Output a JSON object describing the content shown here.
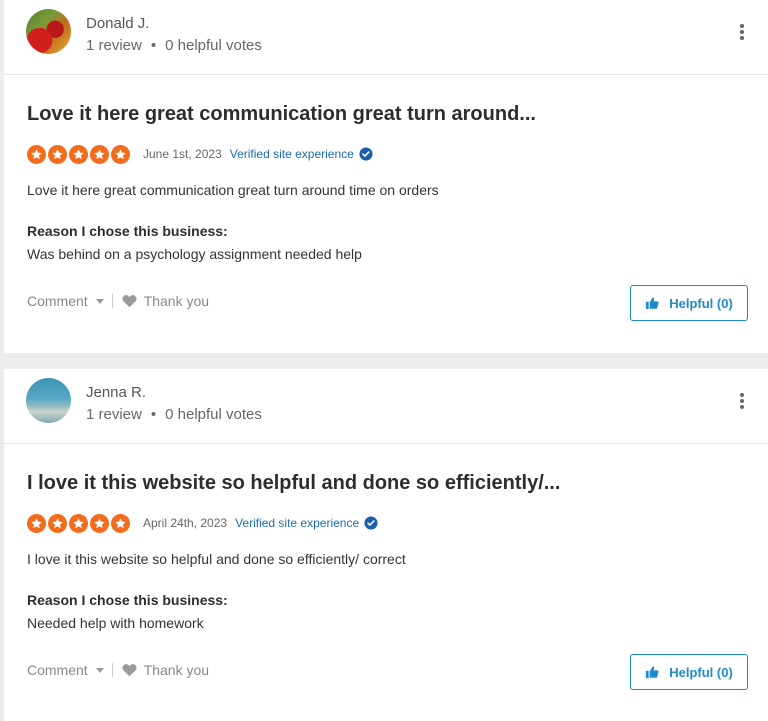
{
  "reviews": [
    {
      "reviewer_name": "Donald J.",
      "reviews_count": "1 review",
      "separator": "•",
      "helpful_votes": "0 helpful votes",
      "title": "Love it here great communication great turn around...",
      "rating": 5,
      "date": "June 1st, 2023",
      "verified_label": "Verified site experience",
      "body": "Love it here great communication great turn around time on orders",
      "reason_label": "Reason I chose this business:",
      "reason_text": "Was behind on a psychology assignment needed help",
      "comment_label": "Comment",
      "thank_label": "Thank you",
      "helpful_label": "Helpful (0)"
    },
    {
      "reviewer_name": "Jenna R.",
      "reviews_count": "1 review",
      "separator": "•",
      "helpful_votes": "0 helpful votes",
      "title": "I love it this website so helpful and done so efficiently/...",
      "rating": 5,
      "date": "April 24th, 2023",
      "verified_label": "Verified site experience",
      "body": "I love it this website so helpful and done so efficiently/ correct",
      "reason_label": "Reason I chose this business:",
      "reason_text": "Needed help with homework",
      "comment_label": "Comment",
      "thank_label": "Thank you",
      "helpful_label": "Helpful (0)"
    }
  ],
  "icons": {
    "star": "star-icon",
    "verified": "verified-check-icon",
    "heart": "heart-icon",
    "thumb": "thumbs-up-icon",
    "more": "more-vertical-icon",
    "caret": "chevron-down-icon"
  },
  "colors": {
    "star": "#f26c1d",
    "link": "#1a6db5",
    "button": "#1f8bc9"
  }
}
